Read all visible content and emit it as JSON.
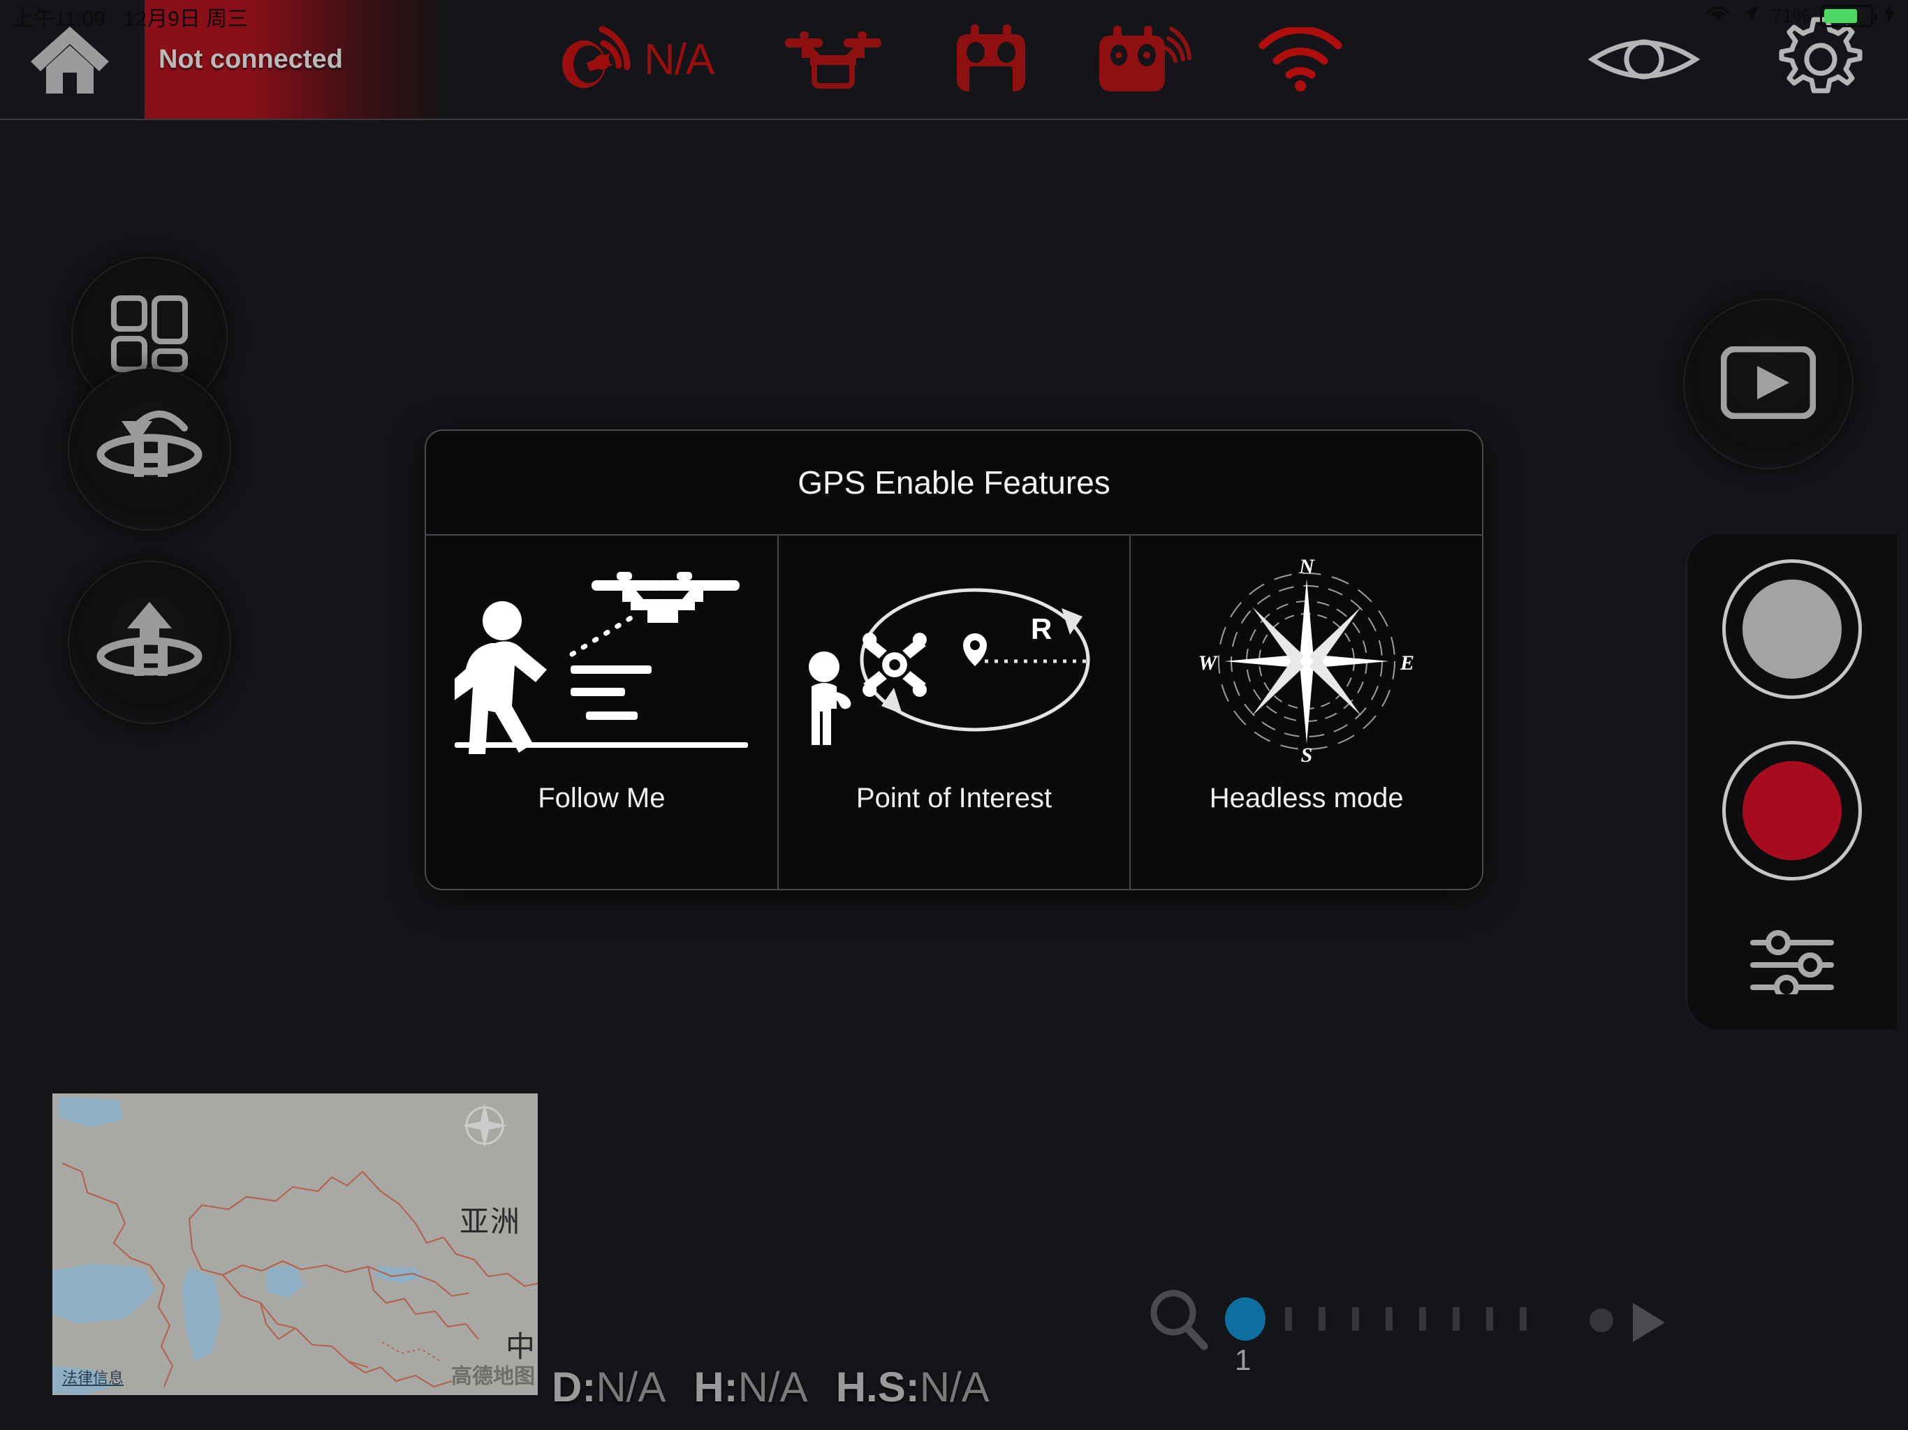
{
  "os_status": {
    "time": "上午11:09",
    "date": "12月9日 周三",
    "battery_percent": "71%",
    "wifi_icon": "wifi-icon",
    "location_icon": "location-arrow-icon",
    "charging_icon": "lightning-bolt-icon"
  },
  "top_bar": {
    "home_icon": "home-icon",
    "connection_status": "Not connected",
    "status_icons": [
      {
        "name": "gps-satellite-icon",
        "value": "N/A"
      },
      {
        "name": "drone-icon",
        "value": ""
      },
      {
        "name": "drone-battery-icon",
        "value": ""
      },
      {
        "name": "remote-controller-signal-icon",
        "value": ""
      },
      {
        "name": "wifi-signal-icon",
        "value": ""
      }
    ],
    "right_icons": [
      {
        "name": "eye-fpv-icon"
      },
      {
        "name": "gear-settings-icon"
      }
    ]
  },
  "left_controls": [
    {
      "name": "dashboard-grid-icon",
      "label": "Dashboard"
    },
    {
      "name": "return-to-home-icon",
      "label": "Return to Home"
    },
    {
      "name": "takeoff-landing-icon",
      "label": "Takeoff / Land"
    }
  ],
  "right_controls": {
    "playback": {
      "name": "playback-gallery-icon",
      "label": "Playback"
    },
    "photo": {
      "name": "photo-shutter-button",
      "label": "Take Photo"
    },
    "video": {
      "name": "video-record-button",
      "label": "Record Video"
    },
    "camera_settings": {
      "name": "camera-settings-sliders-icon",
      "label": "Camera Settings"
    }
  },
  "gps_dialog": {
    "title": "GPS Enable Features",
    "features": [
      {
        "label": "Follow Me",
        "icon": "follow-me-illustration"
      },
      {
        "label": "Point of Interest",
        "icon": "point-of-interest-illustration",
        "radius_label": "R"
      },
      {
        "label": "Headless mode",
        "icon": "compass-rose-illustration",
        "compass": {
          "north": "N",
          "east": "E",
          "south": "S",
          "west": "W"
        }
      }
    ]
  },
  "map": {
    "region_label": "亚洲",
    "country_label": "中",
    "legal_link": "法律信息",
    "provider_watermark": "高德地图",
    "compass_icon": "map-compass-icon"
  },
  "telemetry": [
    {
      "key": "D:",
      "value": "N/A"
    },
    {
      "key": "H:",
      "value": "N/A"
    },
    {
      "key": "H.S:",
      "value": "N/A"
    }
  ],
  "zoom_slider": {
    "search_icon": "magnifier-zoom-icon",
    "current_value": "1",
    "tick_count": 8,
    "next_icon": "play-forward-icon",
    "handle_color": "#0f6ea0"
  },
  "colors": {
    "background": "#141518",
    "disconnected_red": "#9c0d0d",
    "banner_red": "#8b0f18",
    "record_red": "#a80b1e",
    "accent_blue": "#0f6ea0",
    "battery_green": "#4ed964",
    "icon_gray": "#9a9a9c"
  }
}
